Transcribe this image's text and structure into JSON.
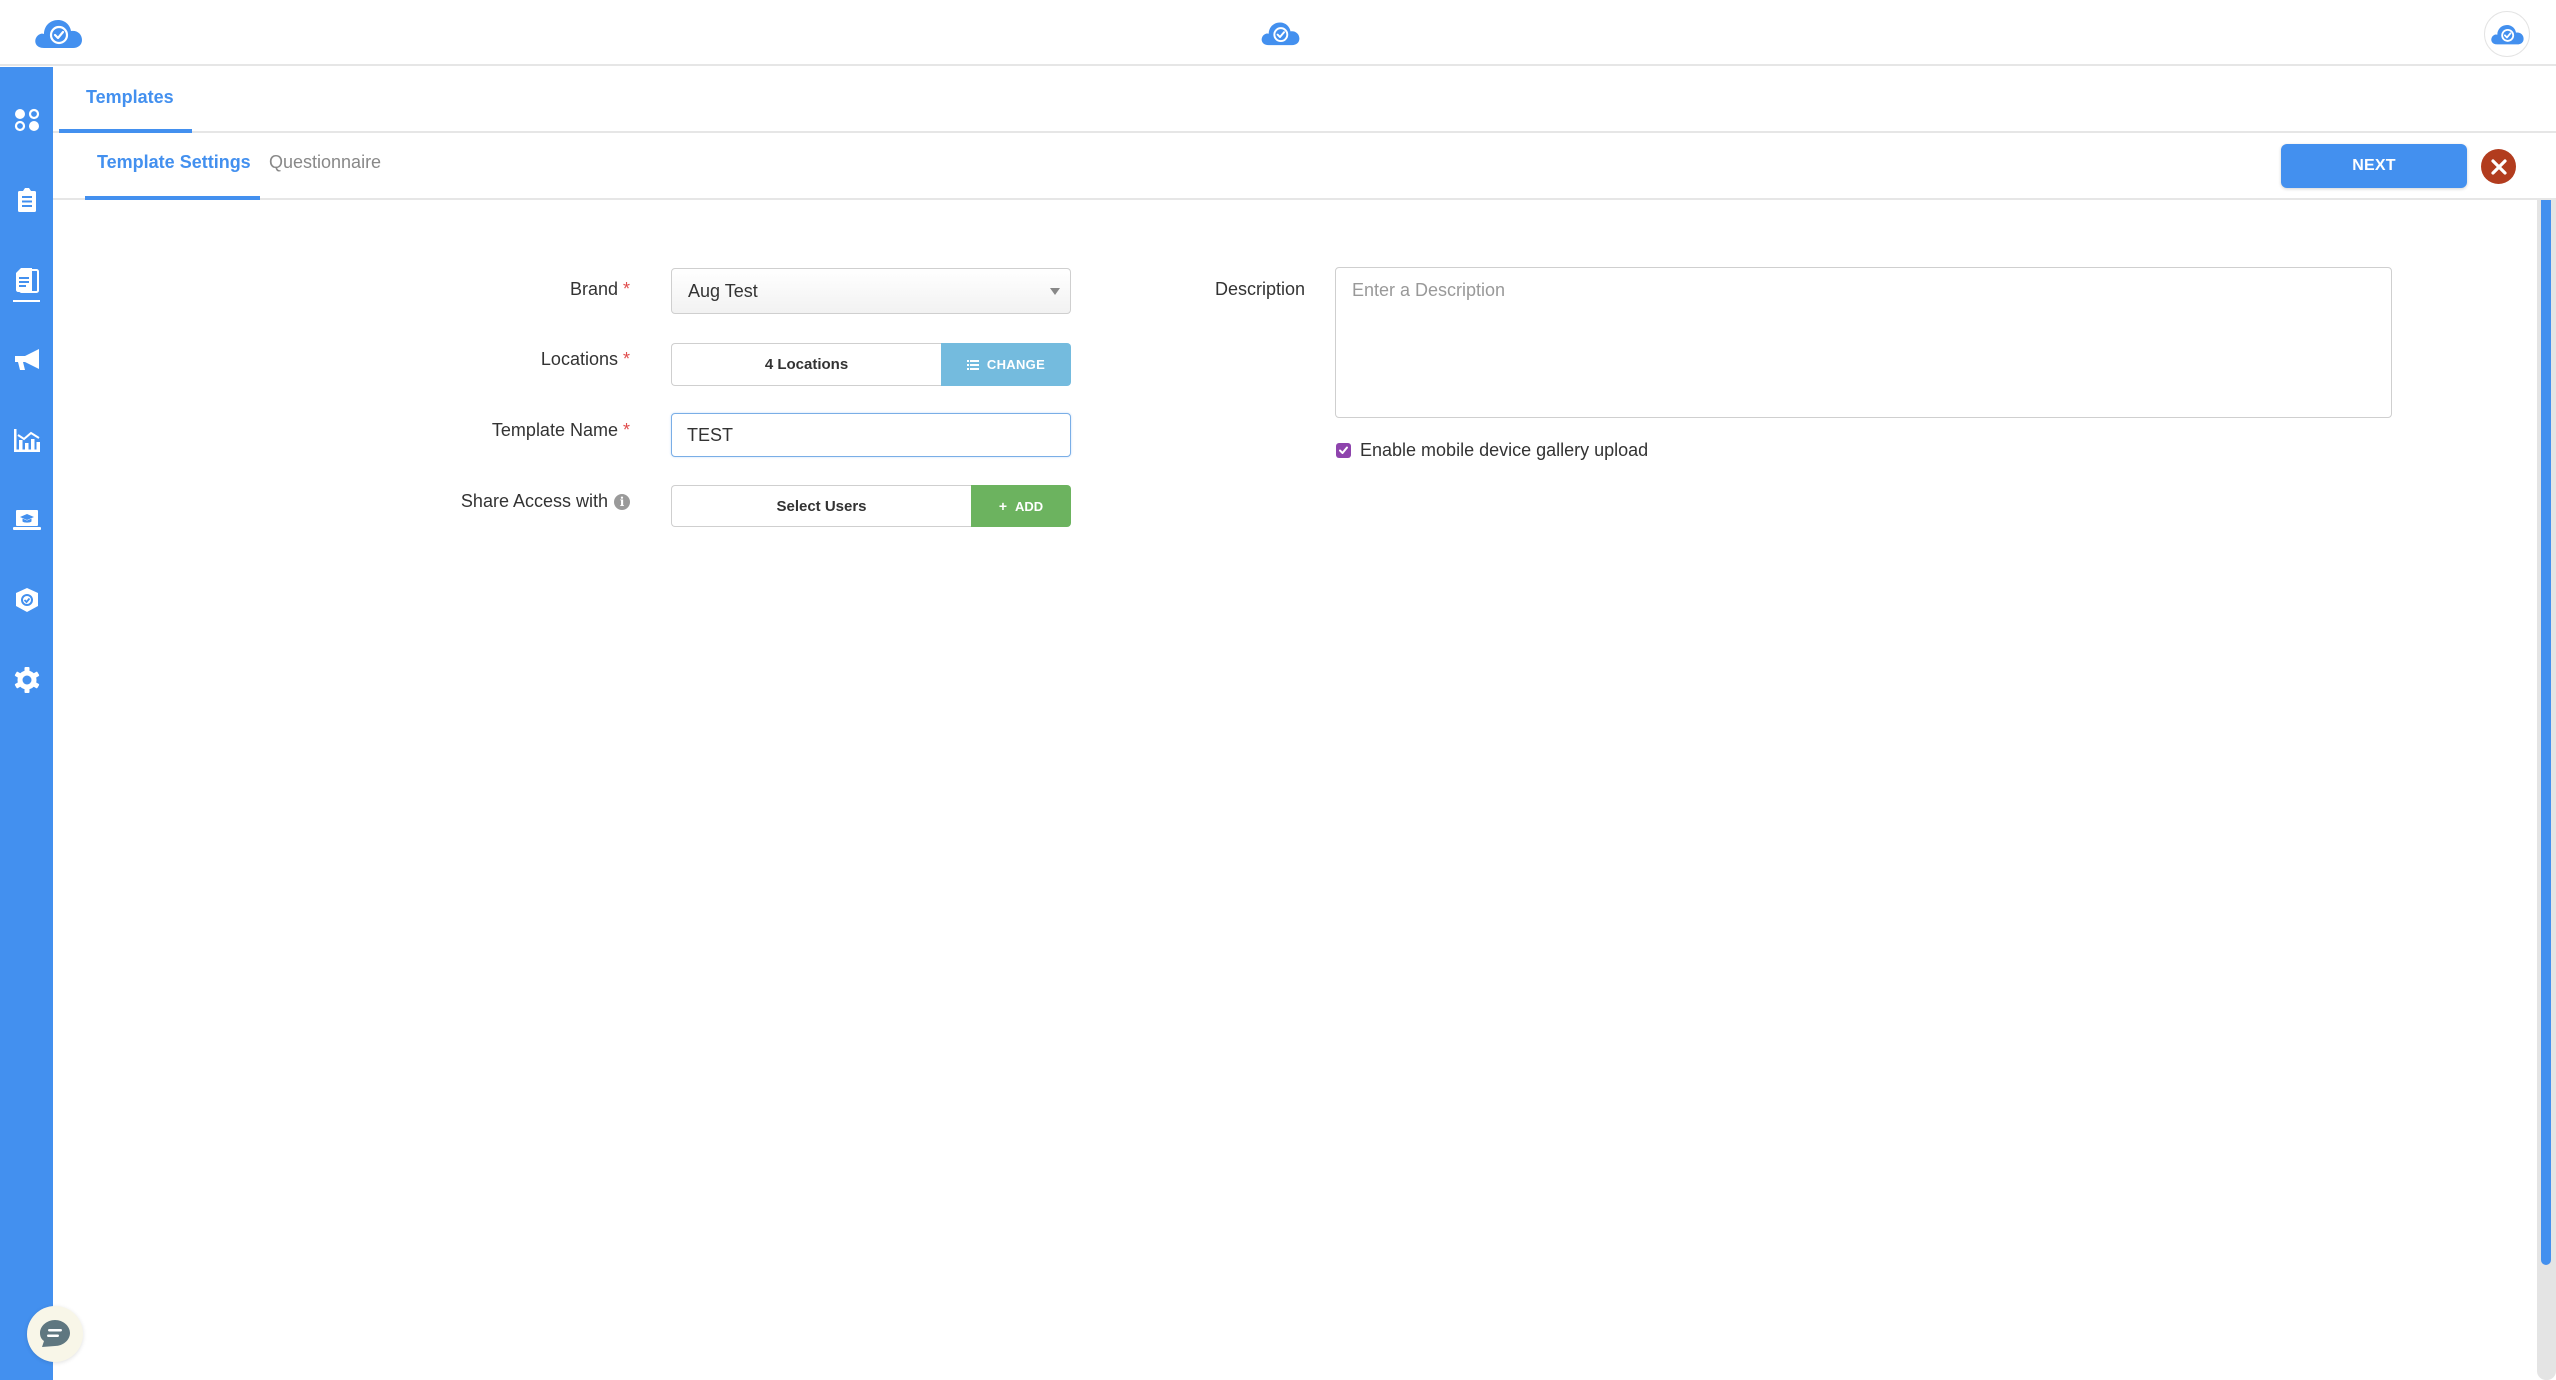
{
  "header": {
    "logo_icon": "cloud-check-icon",
    "center_logo_icon": "cloud-check-icon",
    "profile_icon": "cloud-check-icon"
  },
  "sidebar": {
    "color": "#4390ef",
    "items": [
      {
        "name": "dashboard",
        "icon": "apps-dots-icon"
      },
      {
        "name": "tasks",
        "icon": "clipboard-icon"
      },
      {
        "name": "templates",
        "icon": "documents-icon",
        "active": true
      },
      {
        "name": "announcements",
        "icon": "megaphone-icon"
      },
      {
        "name": "reports",
        "icon": "chart-icon"
      },
      {
        "name": "training",
        "icon": "graduation-laptop-icon"
      },
      {
        "name": "compliance",
        "icon": "shield-check-icon"
      },
      {
        "name": "settings",
        "icon": "gear-icon"
      }
    ]
  },
  "tabs": {
    "primary": [
      {
        "label": "Templates",
        "active": true
      }
    ],
    "secondary": [
      {
        "label": "Template Settings",
        "active": true
      },
      {
        "label": "Questionnaire",
        "active": false
      }
    ]
  },
  "actions": {
    "next_label": "NEXT",
    "close_icon": "close-icon",
    "next_color": "#4390ef",
    "close_color": "#b23c1e"
  },
  "form": {
    "brand": {
      "label": "Brand",
      "required": "*",
      "value": "Aug Test"
    },
    "locations": {
      "label": "Locations",
      "required": "*",
      "value": "4 Locations",
      "button_label": "CHANGE"
    },
    "template_name": {
      "label": "Template Name",
      "required": "*",
      "value": "TEST"
    },
    "share_access": {
      "label": "Share Access with",
      "info_icon": "i",
      "value": "Select Users",
      "button_label": "ADD",
      "button_icon": "+"
    },
    "description": {
      "label": "Description",
      "placeholder": "Enter a Description",
      "value": ""
    },
    "gallery_upload": {
      "label": "Enable mobile device gallery upload",
      "checked": true
    }
  },
  "chat": {
    "icon": "chat-bubble-icon"
  }
}
